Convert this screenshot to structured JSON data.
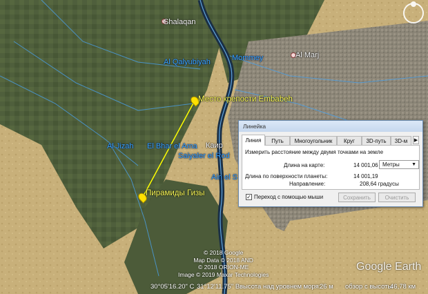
{
  "map": {
    "places": [
      {
        "name": "Shalaqan",
        "style": "white"
      },
      {
        "name": "Al Qalyubiyah",
        "style": "blue"
      },
      {
        "name": "Mommey",
        "style": "blue"
      },
      {
        "name": "Al Marj",
        "style": "white"
      },
      {
        "name": "Каир",
        "style": "white"
      },
      {
        "name": "Al Jizah",
        "style": "blue"
      },
      {
        "name": "El Bhar el Ama",
        "style": "blue"
      },
      {
        "name": "Saiyaler el Rod",
        "style": "blue"
      },
      {
        "name": "Ain el S",
        "style": "blue"
      }
    ],
    "placemarks": [
      {
        "name": "Место крепости Embabeh",
        "color": "#ffe100"
      },
      {
        "name": "Пирамиды Гизы",
        "color": "#ffe100"
      }
    ],
    "measure_line_color": "#ffff00",
    "attribution": [
      "© 2018 Google",
      "Map Data © 2018 AND",
      "© 2018 ORION-ME",
      "Image © 2019 Maxar Technologies"
    ],
    "logo": "Google Earth",
    "compass_icon": "compass-icon"
  },
  "status_bar": {
    "lat": "30°05'16.20\" С",
    "lon": "31°12'11.75\" В",
    "elevation_label": "высота над уровнем моря:",
    "elevation_value": "26 м",
    "eye_label": "обзор с высоты",
    "eye_value": "46,78 км"
  },
  "ruler": {
    "title": "Линейка",
    "tabs": [
      "Линия",
      "Путь",
      "Многоугольник",
      "Круг",
      "3D-путь",
      "3D-м"
    ],
    "active_tab": "Линия",
    "description": "Измерить расстояние между двумя точками на земле",
    "map_length_label": "Длина на карте:",
    "map_length_value": "14 001,06",
    "units": "Метры",
    "ground_length_label": "Длина по поверхности планеты:",
    "ground_length_value": "14 001,19",
    "heading_label": "Направление:",
    "heading_value": "208,64 градусы",
    "mouse_nav_label": "Переход с помощью мыши",
    "mouse_nav_checked": true,
    "save_label": "Сохранить",
    "clear_label": "Очистить"
  }
}
